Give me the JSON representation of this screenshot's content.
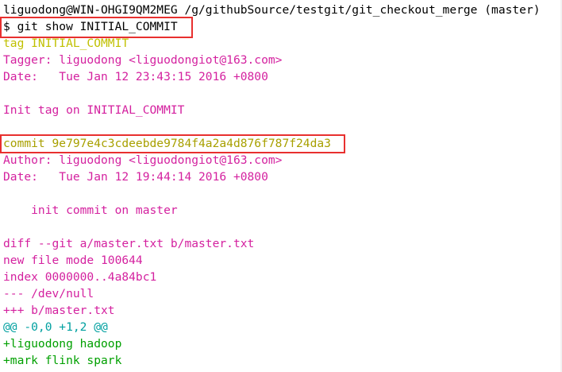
{
  "terminal": {
    "prompt_line": "liguodong@WIN-OHGI9QM2MEG /g/githubSource/testgit/git_checkout_merge (master)",
    "command_line": "$ git show INITIAL_COMMIT",
    "lines": [
      {
        "text": "tag INITIAL_COMMIT",
        "kind": "tag"
      },
      {
        "text": "Tagger: liguodong <liguodongiot@163.com>",
        "kind": "default"
      },
      {
        "text": "Date:   Tue Jan 12 23:43:15 2016 +0800",
        "kind": "default"
      },
      {
        "text": "",
        "kind": "default"
      },
      {
        "text": "Init tag on INITIAL_COMMIT",
        "kind": "default"
      },
      {
        "text": "",
        "kind": "default"
      },
      {
        "text": "commit 9e797e4c3cdeebde9784f4a2a4d876f787f24da3",
        "kind": "commit"
      },
      {
        "text": "Author: liguodong <liguodongiot@163.com>",
        "kind": "default"
      },
      {
        "text": "Date:   Tue Jan 12 19:44:14 2016 +0800",
        "kind": "default"
      },
      {
        "text": "",
        "kind": "default"
      },
      {
        "text": "    init commit on master",
        "kind": "default"
      },
      {
        "text": "",
        "kind": "default"
      },
      {
        "text": "diff --git a/master.txt b/master.txt",
        "kind": "diffhead"
      },
      {
        "text": "new file mode 100644",
        "kind": "diffhead"
      },
      {
        "text": "index 0000000..4a84bc1",
        "kind": "diffhead"
      },
      {
        "text": "--- /dev/null",
        "kind": "diffhead"
      },
      {
        "text": "+++ b/master.txt",
        "kind": "diffhead"
      },
      {
        "text": "@@ -0,0 +1,2 @@",
        "kind": "hunk"
      },
      {
        "text": "+liguodong hadoop",
        "kind": "add"
      },
      {
        "text": "+mark flink spark",
        "kind": "add"
      }
    ]
  },
  "colors": {
    "highlight_box": "#e8302f",
    "default_text": "#d4219f",
    "tag_text": "#c0c000",
    "commit_text": "#a8a000",
    "hunk_text": "#00a0a0",
    "added_text": "#00a000"
  }
}
